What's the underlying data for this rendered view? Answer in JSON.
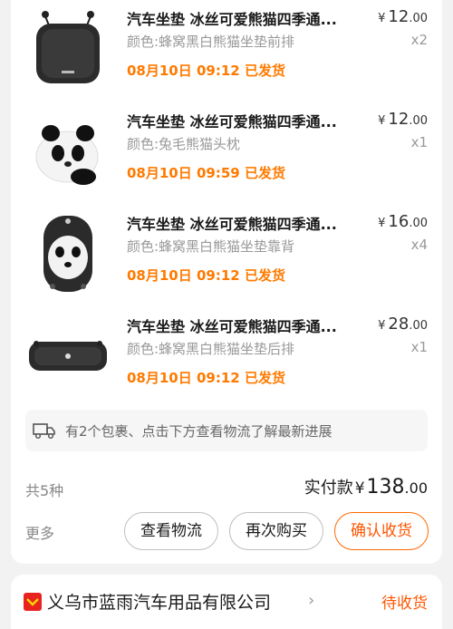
{
  "items": [
    {
      "title": "汽车坐垫 冰丝可爱熊猫四季通...",
      "currency": "¥",
      "price_int": "12",
      "price_dec": ".00",
      "variant": "颜色:蜂窝黑白熊猫坐垫前排",
      "qty": "x2",
      "ship": "08月10日 09:12 已发货",
      "image": "black-seat-cushion-front"
    },
    {
      "title": "汽车坐垫 冰丝可爱熊猫四季通...",
      "currency": "¥",
      "price_int": "12",
      "price_dec": ".00",
      "variant": "颜色:兔毛熊猫头枕",
      "qty": "x1",
      "ship": "08月10日 09:59 已发货",
      "image": "panda-headrest-pillow"
    },
    {
      "title": "汽车坐垫 冰丝可爱熊猫四季通...",
      "currency": "¥",
      "price_int": "16",
      "price_dec": ".00",
      "variant": "颜色:蜂窝黑白熊猫坐垫靠背",
      "qty": "x4",
      "ship": "08月10日 09:12 已发货",
      "image": "panda-seat-back"
    },
    {
      "title": "汽车坐垫 冰丝可爱熊猫四季通...",
      "currency": "¥",
      "price_int": "28",
      "price_dec": ".00",
      "variant": "颜色:蜂窝黑白熊猫坐垫后排",
      "qty": "x1",
      "ship": "08月10日 09:12 已发货",
      "image": "black-seat-cushion-rear"
    }
  ],
  "notice": {
    "icon": "truck-icon",
    "text": "有2个包裹、点击下方查看物流了解最新进展"
  },
  "summary": {
    "count": "共5种",
    "label": "实付款",
    "currency": "¥",
    "amount_int": "138",
    "amount_dec": ".00"
  },
  "actions": {
    "more": "更多",
    "logistics": "查看物流",
    "rebuy": "再次购买",
    "confirm": "确认收货"
  },
  "next_order": {
    "shop_name": "义乌市蓝雨汽车用品有限公司",
    "status": "待收货",
    "icon": "shop-logo-icon"
  },
  "colors": {
    "accent": "#ff5500",
    "ship": "#ff7a00",
    "muted": "#999999"
  }
}
